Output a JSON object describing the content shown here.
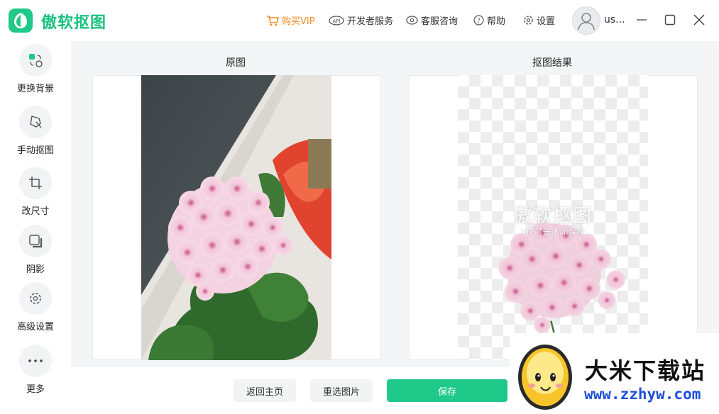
{
  "app": {
    "name": "傲软抠图",
    "brand_color": "#1ec98a"
  },
  "topbar": {
    "vip_label": "购买VIP",
    "developer_label": "开发者服务",
    "support_label": "客服咨询",
    "help_label": "帮助",
    "settings_label": "设置",
    "username": "us..."
  },
  "sidebar": {
    "items": [
      {
        "label": "更换背景",
        "icon": "swap-background-icon"
      },
      {
        "label": "手动抠图",
        "icon": "manual-cutout-icon"
      },
      {
        "label": "改尺寸",
        "icon": "crop-icon"
      },
      {
        "label": "阴影",
        "icon": "shadow-icon"
      },
      {
        "label": "高级设置",
        "icon": "advanced-settings-icon"
      },
      {
        "label": "更多",
        "icon": "more-icon"
      }
    ]
  },
  "main": {
    "original_title": "原图",
    "result_title": "抠图结果",
    "watermark_title": "傲软抠图",
    "watermark_sub": "VIP可去水印保存"
  },
  "bottom": {
    "home_label": "返回主页",
    "reselect_label": "重选图片",
    "save_label": "保存"
  },
  "badge": {
    "name": "大米下载站",
    "url": "www.zzhyw.com"
  }
}
